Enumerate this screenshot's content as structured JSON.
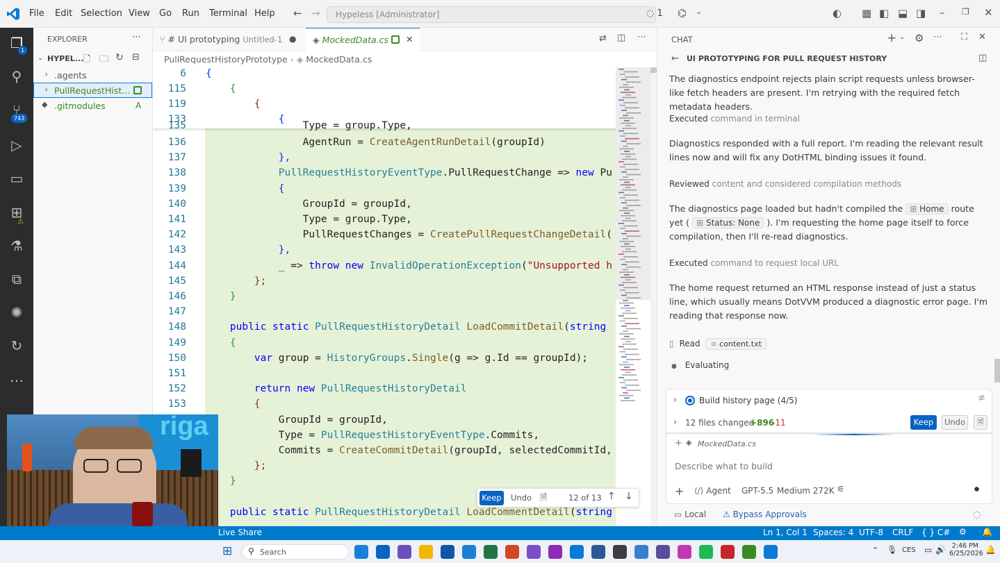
{
  "menu": [
    "File",
    "Edit",
    "Selection",
    "View",
    "Go",
    "Run",
    "Terminal",
    "Help"
  ],
  "command_center": "Hypeless [Administrator]",
  "title_status": "1",
  "activity": {
    "explorer_badge": "1",
    "scm_badge": "743"
  },
  "explorer": {
    "title": "EXPLORER",
    "root": "HYPEL...",
    "items": [
      {
        "name": ".agents",
        "status": ""
      },
      {
        "name": "PullRequestHist...",
        "status": ""
      },
      {
        "name": ".gitmodules",
        "status": "A"
      }
    ]
  },
  "tabs": [
    {
      "label": "# UI prototyping",
      "sub": "Untitled-1"
    },
    {
      "label": "MockedData.cs"
    }
  ],
  "breadcrumb": {
    "folder": "PullRequestHistoryPrototype",
    "file": "MockedData.cs"
  },
  "sticky_lines": [
    {
      "n": "6",
      "t": "{"
    },
    {
      "n": "115",
      "t": "    {"
    },
    {
      "n": "119",
      "t": "        {"
    },
    {
      "n": "133",
      "t": "            {"
    }
  ],
  "code_lines": [
    {
      "n": "136",
      "t": "                AgentRun = CreateAgentRunDetail(groupId)"
    },
    {
      "n": "137",
      "t": "            },"
    },
    {
      "n": "138",
      "t": "            PullRequestHistoryEventType.PullRequestChange => new Pu"
    },
    {
      "n": "139",
      "t": "            {"
    },
    {
      "n": "140",
      "t": "                GroupId = groupId,"
    },
    {
      "n": "141",
      "t": "                Type = group.Type,"
    },
    {
      "n": "142",
      "t": "                PullRequestChanges = CreatePullRequestChangeDetail("
    },
    {
      "n": "143",
      "t": "            },"
    },
    {
      "n": "144",
      "t": "            _ => throw new InvalidOperationException(\"Unsupported h"
    },
    {
      "n": "145",
      "t": "        };"
    },
    {
      "n": "146",
      "t": "    }"
    },
    {
      "n": "147",
      "t": ""
    },
    {
      "n": "148",
      "t": "    public static PullRequestHistoryDetail LoadCommitDetail(string"
    },
    {
      "n": "149",
      "t": "    {"
    },
    {
      "n": "150",
      "t": "        var group = HistoryGroups.Single(g => g.Id == groupId);"
    },
    {
      "n": "151",
      "t": ""
    },
    {
      "n": "152",
      "t": "        return new PullRequestHistoryDetail"
    },
    {
      "n": "153",
      "t": "        {"
    },
    {
      "n": "",
      "t": "            GroupId = groupId,"
    },
    {
      "n": "",
      "t": "            Type = PullRequestHistoryEventType.Commits,"
    },
    {
      "n": "",
      "t": "            Commits = CreateCommitDetail(groupId, selectedCommitId,"
    },
    {
      "n": "",
      "t": "        };"
    },
    {
      "n": "",
      "t": "    }"
    },
    {
      "n": "",
      "t": ""
    },
    {
      "n": "",
      "t": "    public static PullRequestHistoryDetail LoadCommentDetail(string"
    }
  ],
  "code_partial_top": "                Type = group.Type,",
  "code_partial_top_n": "135",
  "inline_review": {
    "keep": "Keep",
    "undo": "Undo",
    "position": "12 of 13"
  },
  "chat": {
    "title": "CHAT",
    "session_title": "UI PROTOTYPING FOR PULL REQUEST HISTORY",
    "p1": "The diagnostics endpoint rejects plain script requests unless browser-like fetch headers are present. I'm retrying with the required fetch metadata headers.",
    "s1a": "Executed",
    "s1b": "command in terminal",
    "p2": "Diagnostics responded with a full report. I'm reading the relevant result lines now and will fix any DotHTML binding issues it found.",
    "s2a": "Reviewed",
    "s2b": "content and considered compilation methods",
    "p3a": "The diagnostics page loaded but hadn't compiled the",
    "p3chip1": "Home",
    "p3b": "route yet (",
    "p3chip2": "Status: None",
    "p3c": "). I'm requesting the home page itself to force compilation, then I'll re-read diagnostics.",
    "s3a": "Executed",
    "s3b": "command to request local URL",
    "p4": "The home request returned an HTML response instead of just a status line, which usually means DotVVM produced a diagnostic error page. I'm reading that response now.",
    "read_label": "Read",
    "read_file": "content.txt",
    "evaluating": "Evaluating",
    "todo": "Build history page (4/5)",
    "files_changed": "12 files changed",
    "added": "+896",
    "removed": "-11",
    "keep": "Keep",
    "undo": "Undo",
    "attached_file": "MockedData.cs",
    "input_placeholder": "Describe what to build",
    "mode": "Agent",
    "model": "GPT-5.5",
    "effort": "Medium 272K",
    "local": "Local",
    "approvals": "Bypass Approvals"
  },
  "status": {
    "live_share": "Live Share",
    "position": "Ln 1, Col 1",
    "spaces": "Spaces: 4",
    "encoding": "UTF-8",
    "eol": "CRLF",
    "lang": "C#"
  },
  "taskbar": {
    "search": "Search",
    "lang": "CES",
    "time": "2:46 PM",
    "date": "6/25/2026"
  },
  "webcam_sign": "riga"
}
